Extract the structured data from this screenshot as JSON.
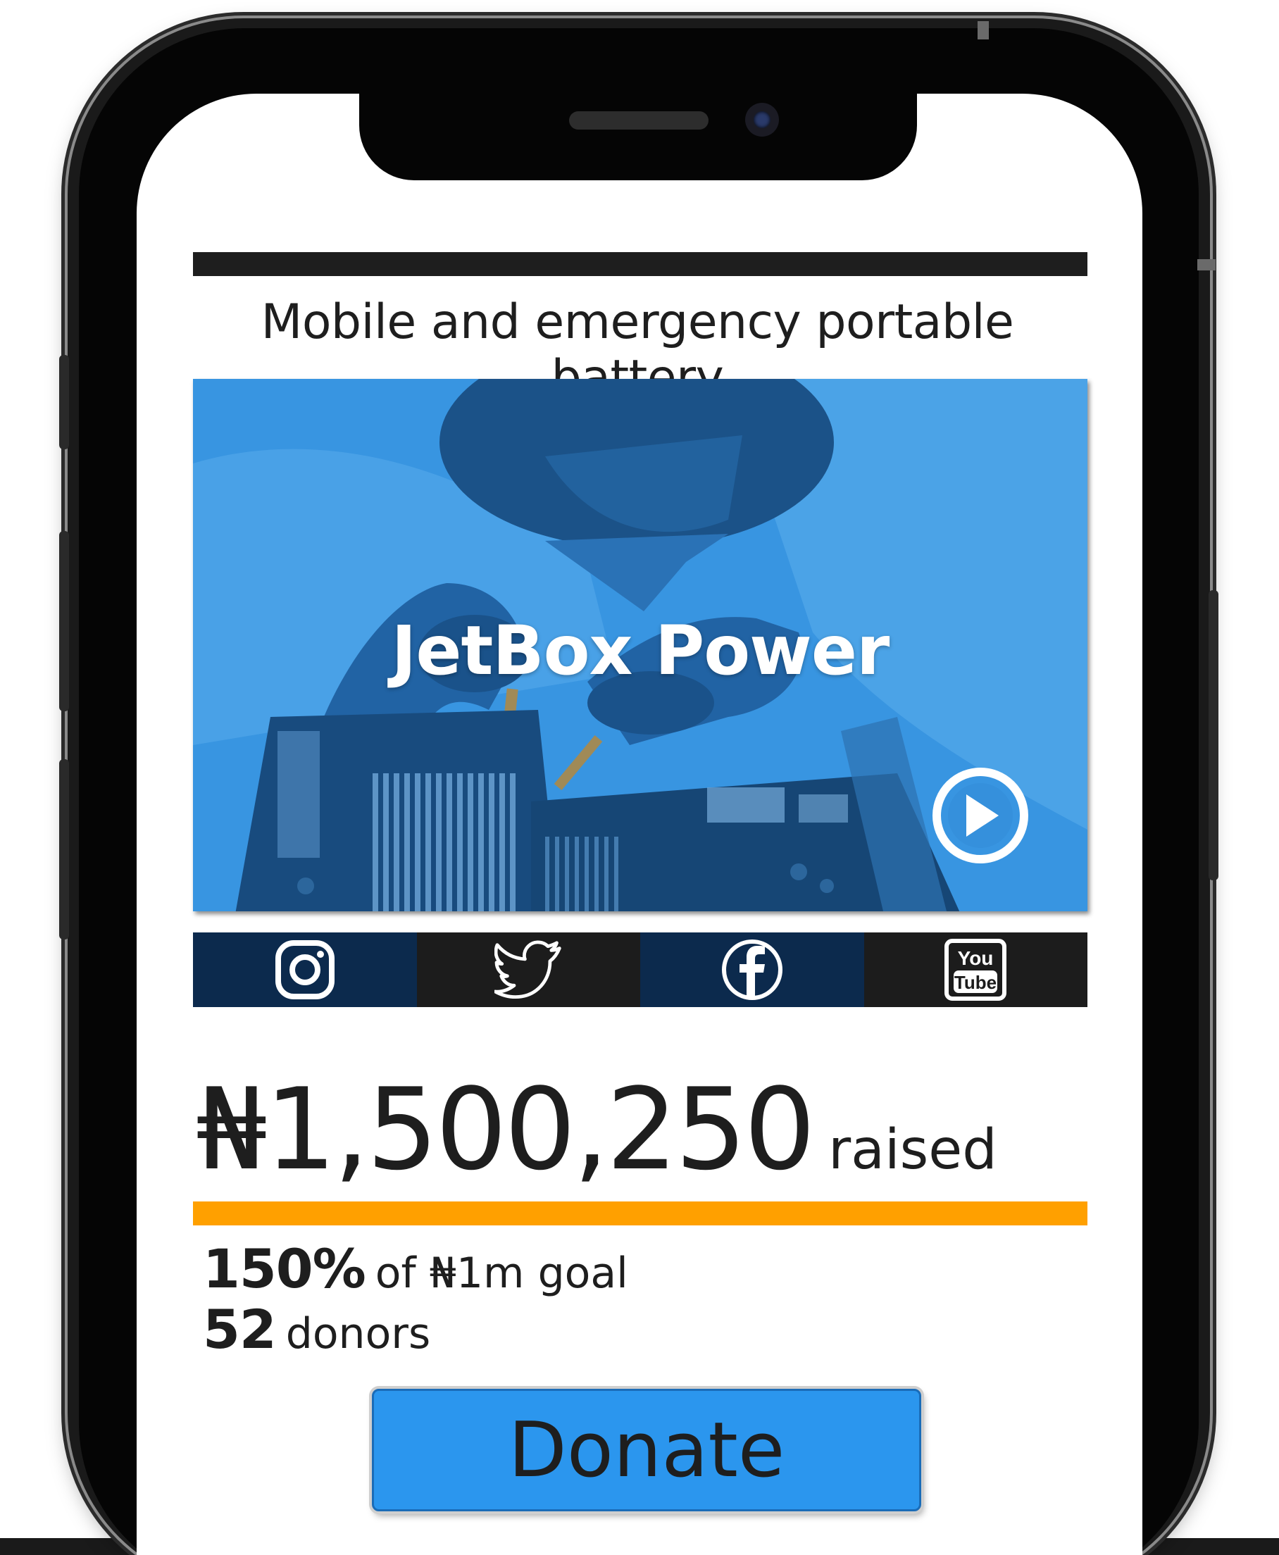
{
  "campaign": {
    "headline": "Mobile and emergency portable battery",
    "video_title": "JetBox Power"
  },
  "social": [
    {
      "icon": "instagram-icon",
      "color": "#0c2a4d"
    },
    {
      "icon": "twitter-icon",
      "color": "#1c1c1c"
    },
    {
      "icon": "facebook-icon",
      "color": "#0c2a4d"
    },
    {
      "icon": "youtube-icon",
      "color": "#1c1c1c",
      "text_top": "You",
      "text_bottom": "Tube"
    }
  ],
  "funding": {
    "amount": "₦1,500,250",
    "raised_label": "raised",
    "progress_fraction": 1.0,
    "progress_color": "#ffa000",
    "percent": "150%",
    "goal_text": "of ₦1m goal",
    "donor_count": "52",
    "donor_label": "donors"
  },
  "donate_label": "Donate",
  "colors": {
    "accent_blue": "#2b96ee",
    "navy": "#0c2a4d",
    "dark": "#1e1e1e"
  }
}
